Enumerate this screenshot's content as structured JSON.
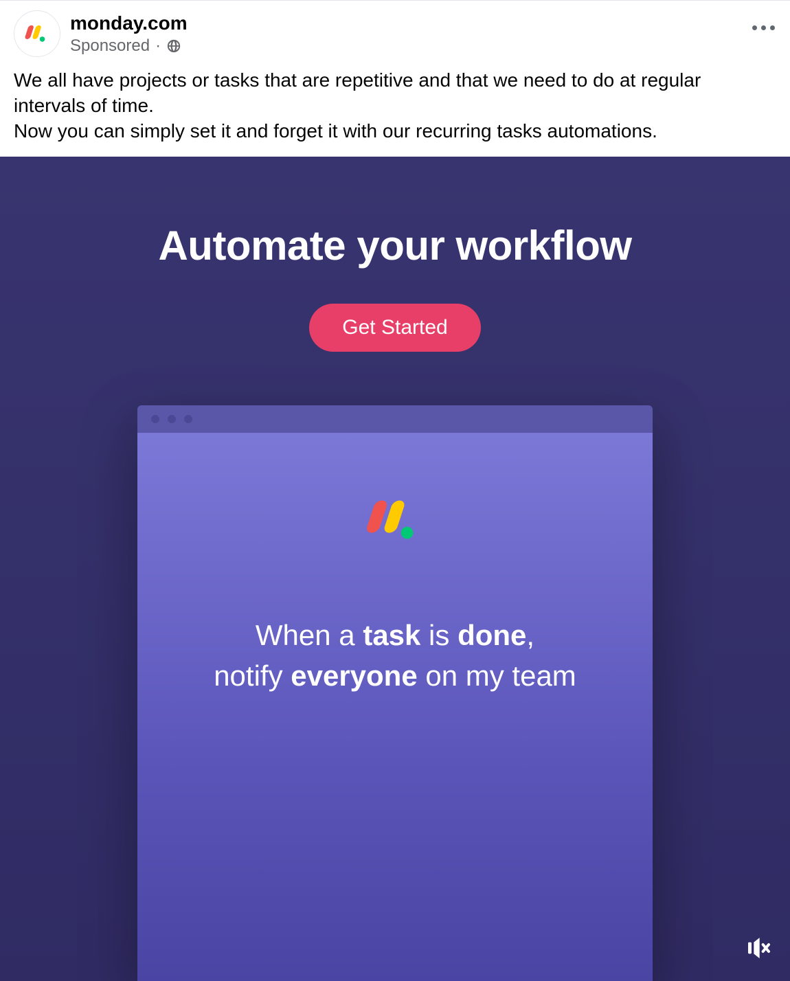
{
  "header": {
    "page_name": "monday.com",
    "sponsored_label": "Sponsored",
    "separator": "·"
  },
  "body": {
    "line1": "We all have projects or tasks that are repetitive and that we need to do at regular intervals of time.",
    "line2": "Now you can simply set it and forget it with our recurring tasks automations."
  },
  "creative": {
    "headline": "Automate your workflow",
    "cta_label": "Get Started",
    "task_line1_pre": "When a ",
    "task_line1_b1": "task",
    "task_line1_mid": " is ",
    "task_line1_b2": "done",
    "task_line1_post": ",",
    "task_line2_pre": "notify ",
    "task_line2_b1": "everyone",
    "task_line2_post": " on my team"
  },
  "icons": {
    "avatar_logo": "monday-logo",
    "globe": "public-globe",
    "options": "more-options",
    "mute": "mute-icon"
  },
  "colors": {
    "brand_red": "#f0524d",
    "brand_yellow": "#ffcb00",
    "brand_green": "#00c875",
    "cta_bg": "#e83f68",
    "creative_bg": "#34306a"
  }
}
